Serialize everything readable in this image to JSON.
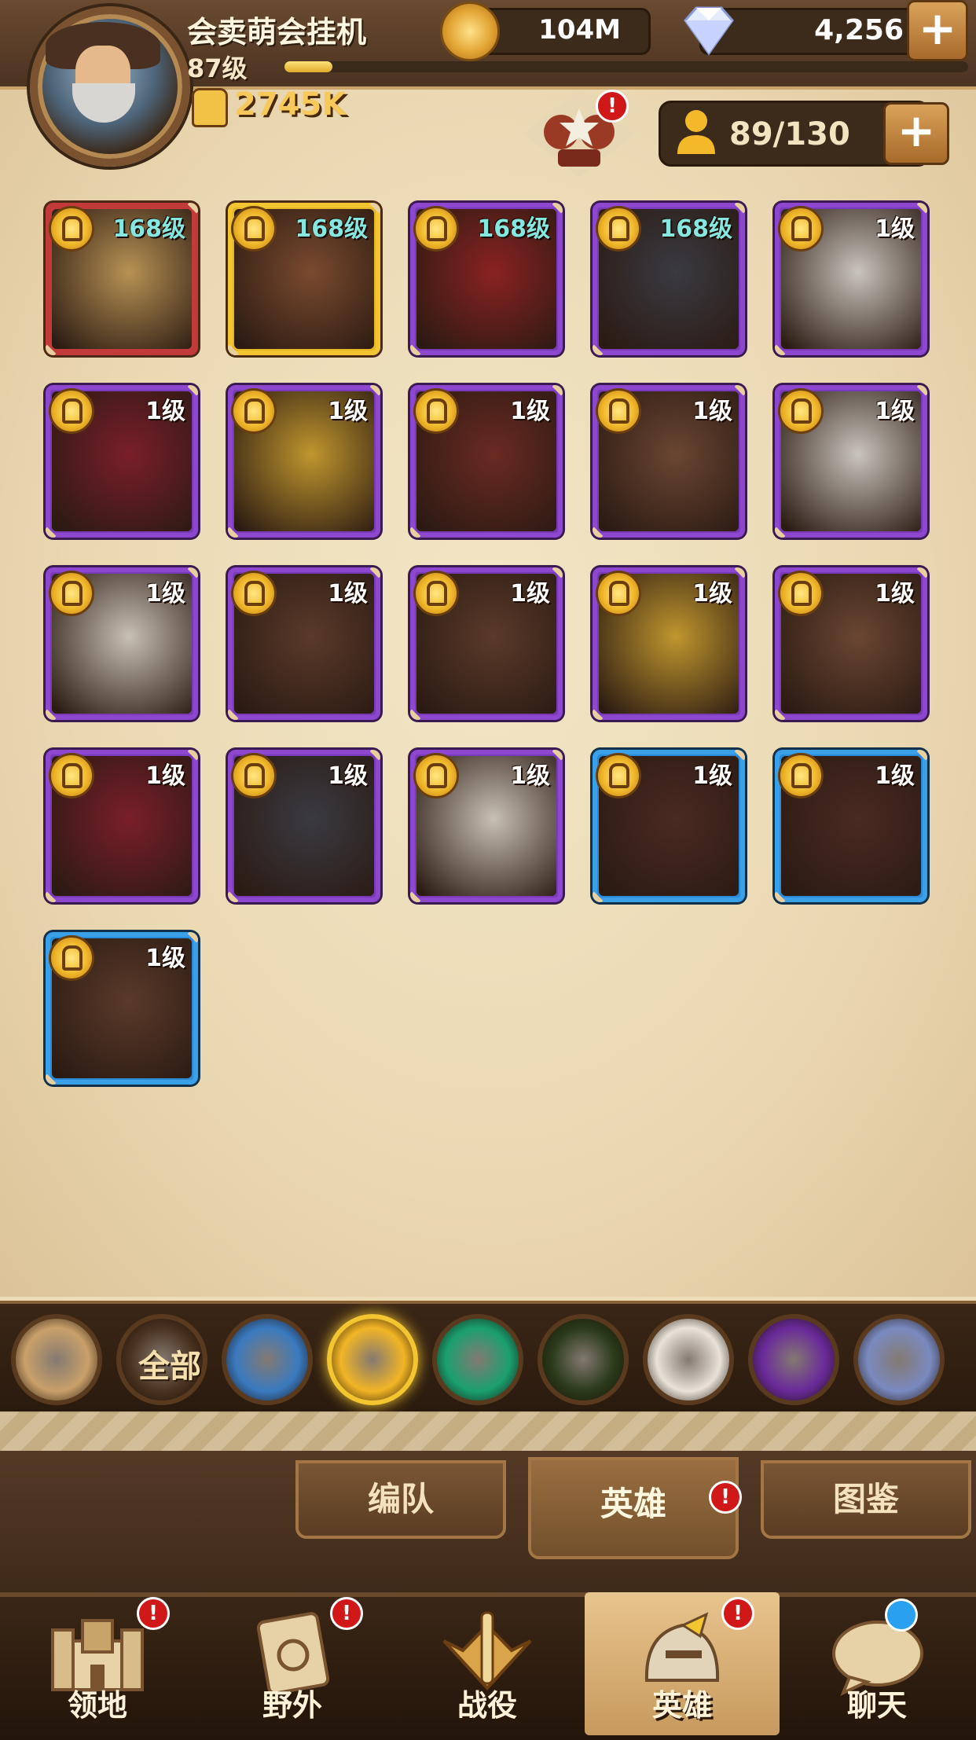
{
  "player": {
    "name": "会卖萌会挂机",
    "level": "87级",
    "power": "2745K",
    "xp_fraction": 0.07
  },
  "currency": {
    "gold": "104M",
    "gems": "4,256"
  },
  "hero_capacity": "89/130",
  "badges": {
    "team": "!",
    "subtab_heroes": "!",
    "nav_domain": "!",
    "nav_wild": "!",
    "nav_heroes": "!"
  },
  "heroes": [
    {
      "level": "168级",
      "rarity": "red",
      "art": "#b89254"
    },
    {
      "level": "168级",
      "rarity": "gold",
      "art": "#7a4a2e"
    },
    {
      "level": "168级",
      "rarity": "purple",
      "art": "#8a2222"
    },
    {
      "level": "168级",
      "rarity": "purple",
      "art": "#3a3a42"
    },
    {
      "level": "1级",
      "rarity": "purple",
      "art": "#c9c4bc"
    },
    {
      "level": "1级",
      "rarity": "purple",
      "art": "#7a1e2a"
    },
    {
      "level": "1级",
      "rarity": "purple",
      "art": "#c0962e"
    },
    {
      "level": "1级",
      "rarity": "purple",
      "art": "#6a2a22"
    },
    {
      "level": "1级",
      "rarity": "purple",
      "art": "#6a4632"
    },
    {
      "level": "1级",
      "rarity": "purple",
      "art": "#c9c4bc"
    },
    {
      "level": "1级",
      "rarity": "purple",
      "art": "#c8c0b4"
    },
    {
      "level": "1级",
      "rarity": "purple",
      "art": "#5a3a2a"
    },
    {
      "level": "1级",
      "rarity": "purple",
      "art": "#5a3a2a"
    },
    {
      "level": "1级",
      "rarity": "purple",
      "art": "#c0962e"
    },
    {
      "level": "1级",
      "rarity": "purple",
      "art": "#6a4632"
    },
    {
      "level": "1级",
      "rarity": "purple",
      "art": "#7a1e2a"
    },
    {
      "level": "1级",
      "rarity": "purple",
      "art": "#3a3a42"
    },
    {
      "level": "1级",
      "rarity": "purple",
      "art": "#c8c0b4"
    },
    {
      "level": "1级",
      "rarity": "blue",
      "art": "#4a2a22"
    },
    {
      "level": "1级",
      "rarity": "blue",
      "art": "#4a2a22"
    },
    {
      "level": "1级",
      "rarity": "blue",
      "art": "#5a3a2a"
    }
  ],
  "filters": [
    {
      "name": "collapse",
      "color": "#c9a06a"
    },
    {
      "name": "all",
      "label": "全部",
      "color": "#4a3220"
    },
    {
      "name": "star",
      "color": "#3a7ac0"
    },
    {
      "name": "sun",
      "color": "#f2b526"
    },
    {
      "name": "lotus",
      "color": "#1aa070"
    },
    {
      "name": "eye",
      "color": "#2a3a1a"
    },
    {
      "name": "light",
      "color": "#e8e2d8"
    },
    {
      "name": "dark",
      "color": "#6a2a9a"
    },
    {
      "name": "celestial",
      "color": "#7a8ac0"
    }
  ],
  "subtabs": [
    {
      "label": "编队"
    },
    {
      "label": "英雄"
    },
    {
      "label": "图鉴"
    }
  ],
  "nav": [
    {
      "label": "领地",
      "icon": "castle-icon"
    },
    {
      "label": "野外",
      "icon": "map-scroll-icon"
    },
    {
      "label": "战役",
      "icon": "sword-emblem-icon"
    },
    {
      "label": "英雄",
      "icon": "helmet-icon"
    },
    {
      "label": "聊天",
      "icon": "chat-icon"
    }
  ],
  "colors": {
    "accent_gold": "#f2c531",
    "badge_red": "#d01818",
    "rarity_red": "#c23a3a",
    "rarity_purple": "#8e48d0",
    "rarity_blue": "#3aa0e8"
  }
}
